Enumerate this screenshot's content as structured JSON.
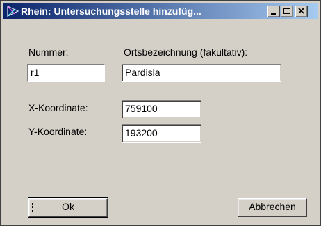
{
  "window": {
    "title": "Rhein: Untersuchungsstelle hinzufüg...",
    "title_gradient_start": "#0a246a",
    "title_gradient_end": "#a6caf0",
    "face_color": "#d4d0c8"
  },
  "form": {
    "nummer_label": "Nummer:",
    "nummer_value": "r1",
    "ort_label": "Ortsbezeichnung (fakultativ):",
    "ort_value": "Pardisla",
    "x_label": "X-Koordinate:",
    "x_value": "759100",
    "y_label": "Y-Koordinate:",
    "y_value": "193200"
  },
  "buttons": {
    "ok_mnemonic": "O",
    "ok_rest": "k",
    "cancel_mnemonic": "A",
    "cancel_rest": "bbrechen"
  },
  "icons": {
    "app": "app-icon",
    "minimize": "minimize-icon",
    "maximize": "maximize-icon",
    "close": "close-icon"
  }
}
